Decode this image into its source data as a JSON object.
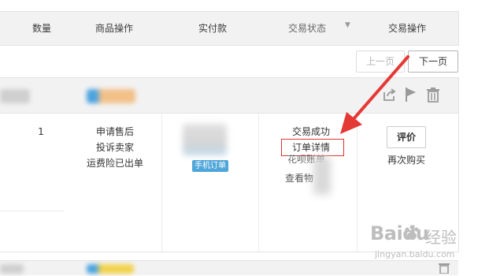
{
  "table_header": {
    "col_quantity": "数量",
    "col_item_actions": "商品操作",
    "col_paid": "实付款",
    "col_status": "交易状态",
    "col_trade_actions": "交易操作"
  },
  "pager": {
    "prev_label": "上一页",
    "next_label": "下一页"
  },
  "order": {
    "quantity": "1",
    "item_actions": [
      "申请售后",
      "投诉卖家",
      "运费险已出单"
    ],
    "mobile_order_badge": "手机订单",
    "status_text": "交易成功",
    "order_detail_link": "订单详情",
    "invoice_link": "花呗账单",
    "view_link": "查看物流",
    "review_button": "评价",
    "rebuy_link": "再次购买"
  },
  "watermark": {
    "brand": "Baidu",
    "brand_cn": "经验",
    "url": "jingyan.baidu.com"
  },
  "colors": {
    "header_bg": "#f2f2f2",
    "highlight_border": "#d33",
    "arrow": "#e53935",
    "badge": "#4fa6d9"
  }
}
